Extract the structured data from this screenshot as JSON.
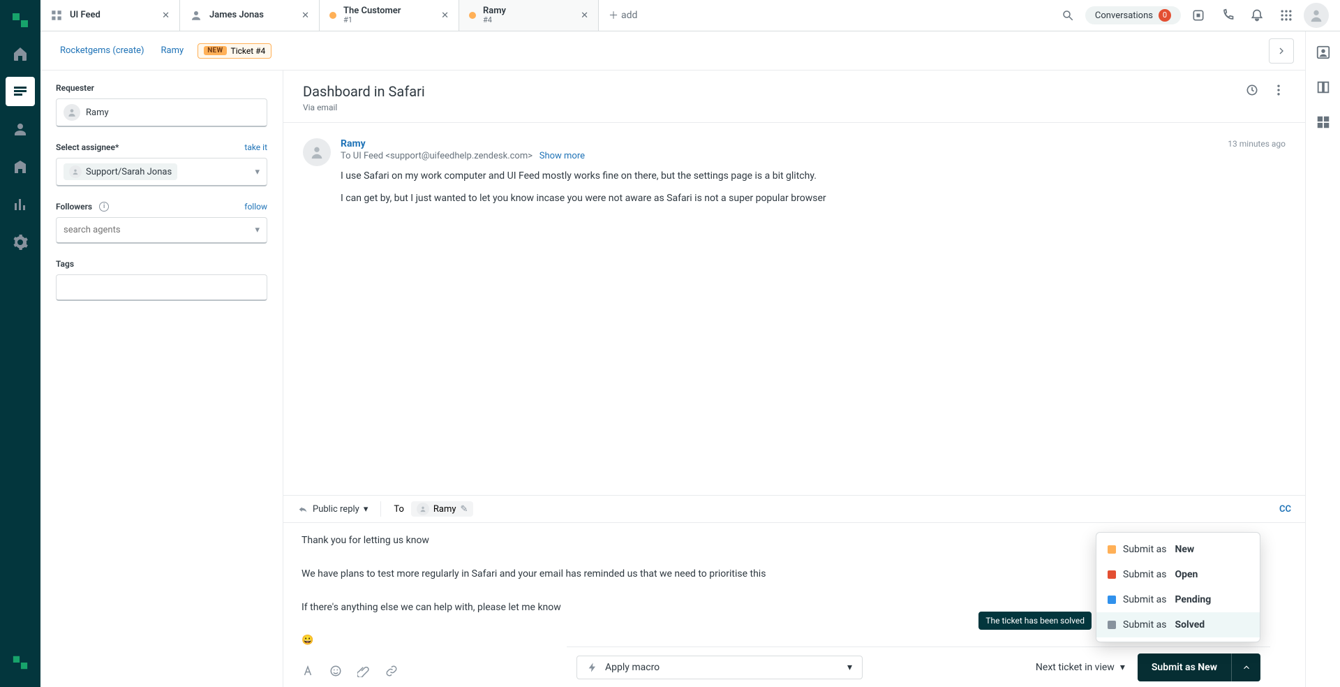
{
  "tabs": [
    {
      "title": "UI Feed",
      "sub": ""
    },
    {
      "title": "James Jonas",
      "sub": ""
    },
    {
      "title": "The Customer",
      "sub": "#1"
    },
    {
      "title": "Ramy",
      "sub": "#4"
    }
  ],
  "tabbar": {
    "add_label": "add",
    "conversations_label": "Conversations",
    "conversations_badge": "0"
  },
  "crumbs": {
    "link1": "Rocketgems (create)",
    "link2": "Ramy",
    "status_pill": "NEW",
    "status_text": "Ticket #4"
  },
  "sidebar": {
    "requester_label": "Requester",
    "requester_name": "Ramy",
    "assignee_label": "Select assignee*",
    "take_it": "take it",
    "assignee_value": "Support/Sarah Jonas",
    "followers_label": "Followers",
    "follow": "follow",
    "followers_placeholder": "search agents",
    "tags_label": "Tags"
  },
  "conversation": {
    "subject": "Dashboard in Safari",
    "via": "Via email",
    "author": "Ramy",
    "timestamp": "13 minutes ago",
    "to_line": "To UI Feed <support@uifeedhelp.zendesk.com>",
    "show_more": "Show more",
    "body_line1": "I use Safari on my work computer and UI Feed mostly works fine on there, but the settings page is a bit glitchy.",
    "body_line2": "I can get by, but I just wanted to let you know incase you were not aware as Safari is not a super popular browser"
  },
  "reply": {
    "type_label": "Public reply",
    "to_label": "To",
    "recipient": "Ramy",
    "cc": "CC",
    "line1": "Thank you for letting us know",
    "line2": "We have plans to test more regularly in Safari and your email has reminded us that we need to prioritise this",
    "line3": "If there's anything else we can help with, please let me know",
    "emoji": "😀"
  },
  "footer": {
    "macro_label": "Apply macro",
    "next_ticket": "Next ticket in view",
    "submit_prefix": "Submit as ",
    "submit_status": "New"
  },
  "submit_menu": {
    "new": "New",
    "open": "Open",
    "pending": "Pending",
    "solved": "Solved",
    "prefix": "Submit as "
  },
  "tooltip": "The ticket has been solved"
}
